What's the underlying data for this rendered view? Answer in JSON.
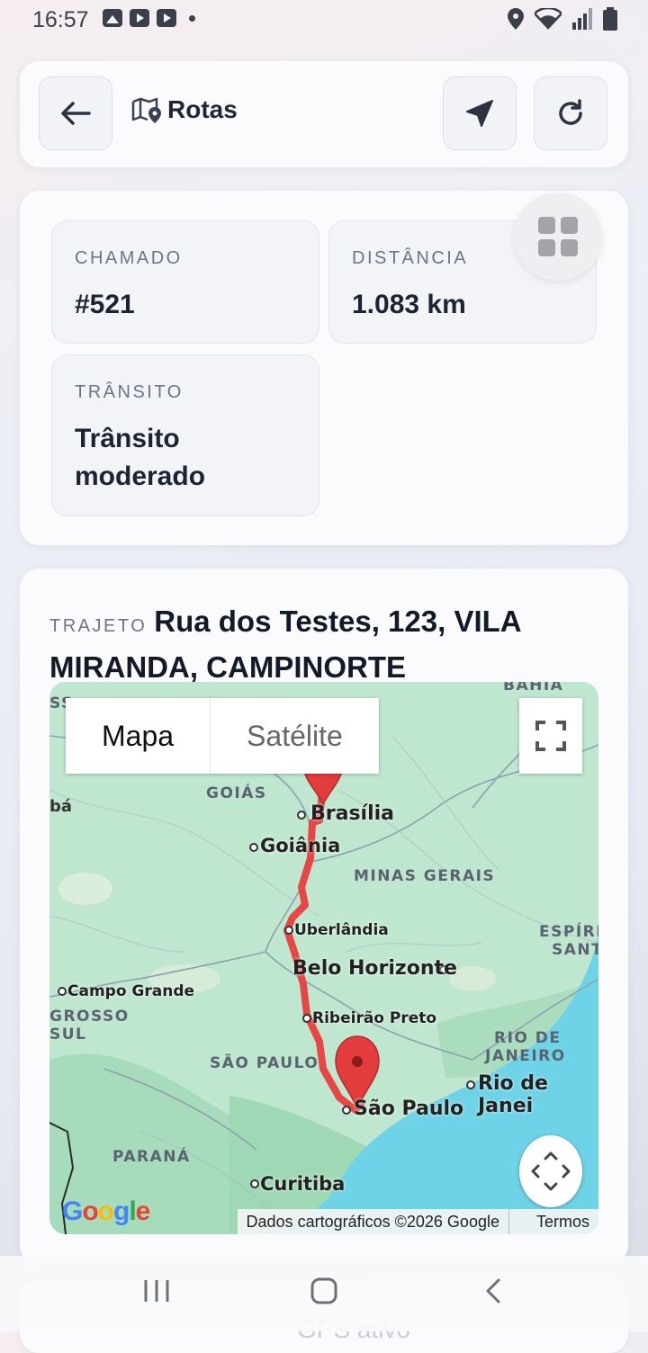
{
  "status_bar": {
    "time": "16:57"
  },
  "header": {
    "title": "Rotas"
  },
  "info": {
    "chamado": {
      "label": "CHAMADO",
      "value": "#521"
    },
    "distancia": {
      "label": "DISTÂNCIA",
      "value": "1.083 km"
    },
    "transito": {
      "label": "TRÂNSITO",
      "value": "Trânsito moderado"
    }
  },
  "route": {
    "label": "TRAJETO",
    "address": "Rua dos Testes, 123, VILA MIRANDA, CAMPINORTE"
  },
  "map": {
    "type_map": "Mapa",
    "type_satellite": "Satélite",
    "attribution": "Dados cartográficos ©2026 Google",
    "terms": "Termos",
    "logo": "Google",
    "places": {
      "bahia": "BAHIA",
      "goias": "GOIÁS",
      "brasilia": "Brasília",
      "goiania": "Goiânia",
      "minas": "MINAS GERAIS",
      "uberlandia": "Uberlândia",
      "espirito1": "ESPÍRI",
      "espirito2": "SANT",
      "bh": "Belo Horizonte",
      "campo": "Campo Grande",
      "grosso": "GROSSO",
      "sul": "SUL",
      "ribeirao": "Ribeirão Preto",
      "rio1": "RIO DE",
      "rio2": "JANEIRO",
      "sp_state": "SÃO PAULO",
      "rio_city": "Rio de Janei",
      "sp_city": "São Paulo",
      "parana": "PARANÁ",
      "curitiba": "Curitiba",
      "ss": "SS",
      "ba": "bá"
    },
    "colors": {
      "route": "#e84545",
      "water": "#6ed3e6",
      "land": "#bfe7cf"
    }
  },
  "next_card": {
    "peek": "GPS ativo"
  }
}
